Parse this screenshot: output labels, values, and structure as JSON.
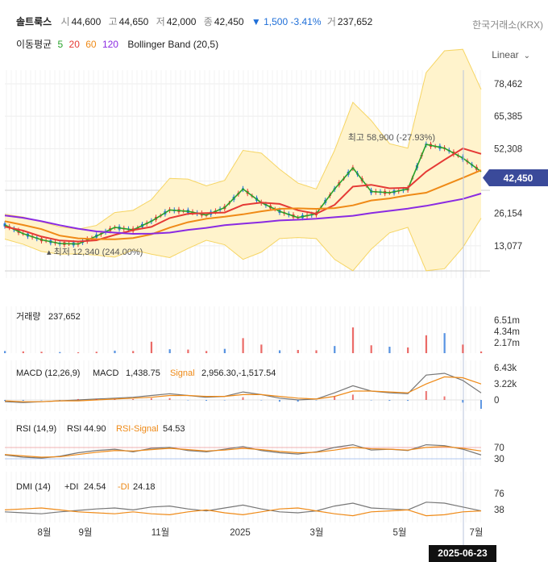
{
  "header": {
    "name": "솔트룩스",
    "open_k": "시",
    "open_v": "44,600",
    "high_k": "고",
    "high_v": "44,650",
    "low_k": "저",
    "low_v": "42,000",
    "close_k": "종",
    "close_v": "42,450",
    "change": "▼ 1,500",
    "change_pct": "-3.41%",
    "vol_k": "거",
    "vol_v": "237,652"
  },
  "exchange": "한국거래소(KRX)",
  "ma": {
    "title": "이동평균",
    "p5": "5",
    "p20": "20",
    "p60": "60",
    "p120": "120",
    "bb": "Bollinger Band (20,5)"
  },
  "scale_mode": "Linear",
  "colors": {
    "ma5": "#27a22a",
    "ma20": "#e53935",
    "ma60": "#ef8a17",
    "ma120": "#8a2be2",
    "up": "#e53935",
    "down": "#1f6fd8",
    "band": "#fff3cc",
    "bandLine": "#f6d563",
    "accent": "#3a4a9a"
  },
  "chart_data": [
    {
      "type": "line",
      "title": "",
      "y_ticks": [
        "78,462",
        "65,385",
        "52,308",
        "39,231",
        "26,154",
        "13,077"
      ],
      "current_price": "42,450",
      "high_label": "최고 58,900 (-27.93%)",
      "low_label": "최저 12,340 (244.00%)",
      "x_ticks": [
        "8월",
        "9월",
        "11월",
        "2025",
        "3월",
        "5월",
        "7월"
      ],
      "cursor_date": "2025-06-23",
      "ylim": [
        0,
        84000
      ],
      "series": [
        {
          "name": "5",
          "values": [
            21500,
            18000,
            15500,
            14000,
            13800,
            17000,
            20500,
            19500,
            23000,
            27500,
            27000,
            25500,
            28500,
            36000,
            30500,
            27000,
            24500,
            26000,
            36000,
            44500,
            35000,
            34500,
            36000,
            54000,
            52500,
            48500,
            43000
          ]
        },
        {
          "name": "20",
          "values": [
            20800,
            19200,
            16800,
            15200,
            14800,
            15300,
            17500,
            19400,
            20700,
            24300,
            26000,
            26300,
            26500,
            29600,
            30500,
            30000,
            27400,
            26000,
            29600,
            37000,
            37700,
            36300,
            36500,
            43000,
            47800,
            52400,
            50200
          ]
        },
        {
          "name": "60",
          "values": [
            23000,
            21500,
            19800,
            17200,
            16100,
            15800,
            15700,
            16200,
            17700,
            20400,
            22600,
            24000,
            24800,
            25800,
            27000,
            28000,
            28200,
            28000,
            28300,
            29400,
            31400,
            32200,
            33500,
            34500,
            37500,
            40500,
            43600
          ]
        },
        {
          "name": "120",
          "values": [
            25300,
            24400,
            23000,
            21400,
            20000,
            18900,
            18400,
            17900,
            18000,
            18400,
            19500,
            20300,
            21400,
            22000,
            22600,
            23300,
            23600,
            24000,
            24600,
            25200,
            26300,
            27200,
            28100,
            29200,
            30600,
            32000,
            34200
          ]
        }
      ]
    },
    {
      "type": "bar",
      "title": "거래량",
      "title_value": "237,652",
      "y_ticks": [
        "6.51m",
        "4.34m",
        "2.17m"
      ],
      "values": [
        0.3,
        0.25,
        0.2,
        0.15,
        0.12,
        0.2,
        0.35,
        0.3,
        1.6,
        0.55,
        0.5,
        0.3,
        0.6,
        2.1,
        1.2,
        0.4,
        0.45,
        0.4,
        1.0,
        3.6,
        1.1,
        0.9,
        0.8,
        2.5,
        2.8,
        1.2,
        0.24
      ]
    },
    {
      "type": "line",
      "title": "MACD (12,26,9)",
      "macd_label": "MACD",
      "macd_value": "1,438.75",
      "signal_label": "Signal",
      "signal_value": "2,956.30",
      "hist_value": "-1,517.54",
      "y_ticks": [
        "6.43k",
        "3.22k",
        "0"
      ]
    },
    {
      "type": "line",
      "title": "RSI (14,9)",
      "rsi_label": "RSI",
      "rsi_value": "44.90",
      "sig_label": "RSI-Signal",
      "sig_value": "54.53",
      "y_ticks": [
        "70",
        "30"
      ]
    },
    {
      "type": "line",
      "title": "DMI (14)",
      "pdi_label": "+DI",
      "pdi_value": "24.54",
      "mdi_label": "-DI",
      "mdi_value": "24.18",
      "y_ticks": [
        "76",
        "38"
      ]
    }
  ]
}
